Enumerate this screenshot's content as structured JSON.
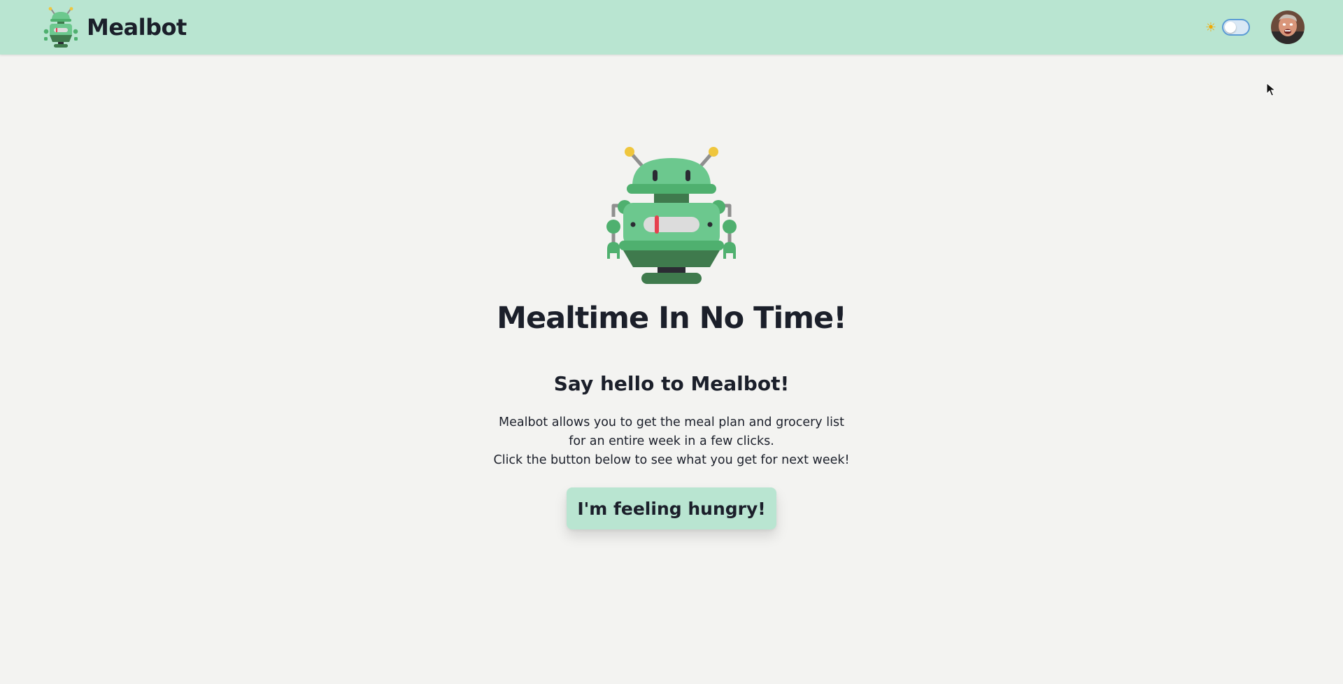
{
  "app": {
    "name": "Mealbot"
  },
  "header": {
    "logo_icon": "robot-logo-icon",
    "theme_icon": "sun-icon",
    "theme_icon_glyph": "☀",
    "theme_toggle_on": false,
    "avatar_icon": "user-avatar"
  },
  "hero": {
    "illustration": "robot-illustration",
    "headline": "Mealtime In No Time!",
    "subtitle": "Say hello to Mealbot!",
    "description_lines": [
      "Mealbot allows you to get the meal plan and grocery list",
      "for an entire week in a few clicks.",
      "Click the button below to see what you get for next week!"
    ],
    "cta_label": "I'm feeling hungry!"
  },
  "colors": {
    "navbar_bg": "#b9e5d1",
    "page_bg": "#f3f3f1",
    "text": "#1b1f2a",
    "robot_green": "#6cc88e",
    "robot_dark_green": "#3f7a4d",
    "antenna_yellow": "#efc63d",
    "indicator_red": "#e6404e"
  }
}
